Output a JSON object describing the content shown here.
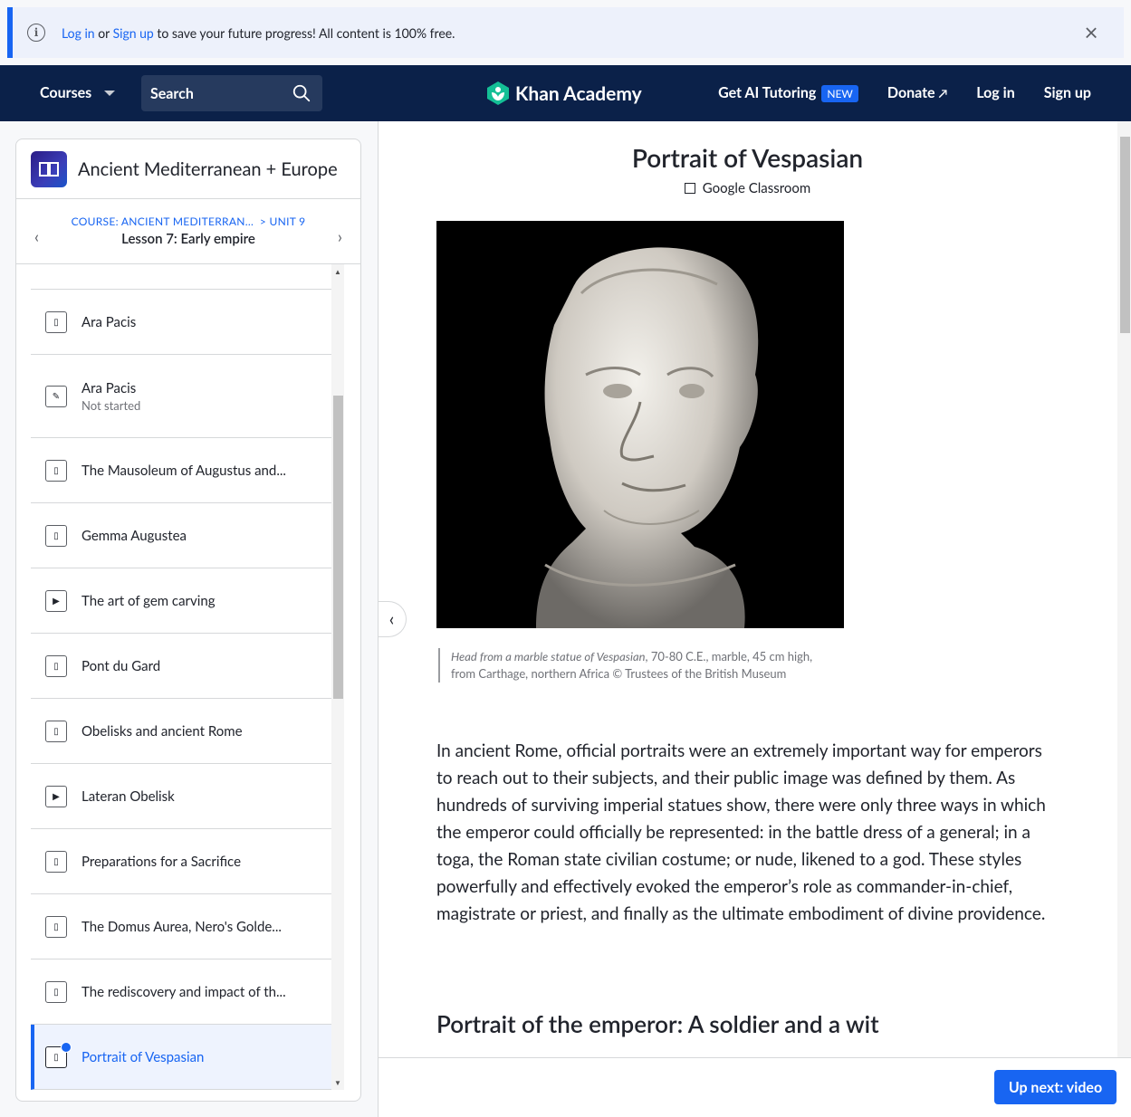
{
  "banner": {
    "login": "Log in",
    "or": "or",
    "signup": "Sign up",
    "message": "to save your future progress! All content is 100% free."
  },
  "header": {
    "courses": "Courses",
    "search_label": "Search",
    "logo_text": "Khan Academy",
    "ai_tutoring": "Get AI Tutoring",
    "new_badge": "NEW",
    "donate": "Donate",
    "login": "Log in",
    "signup": "Sign up",
    "colors": {
      "bg": "#0b2149",
      "accent": "#1865f2",
      "logo_green": "#14bf96"
    }
  },
  "sidebar": {
    "course_title": "Ancient Mediterranean + Europe",
    "breadcrumb_course": "COURSE: ANCIENT MEDITERRAN...",
    "breadcrumb_unit": "> UNIT 9",
    "lesson_title": "Lesson 7: Early empire",
    "items": [
      {
        "label": "Ara Pacis",
        "icon": "article-icon",
        "sub": ""
      },
      {
        "label": "Ara Pacis",
        "icon": "exercise-icon",
        "sub": "Not started"
      },
      {
        "label": "The Mausoleum of Augustus and...",
        "icon": "article-icon",
        "sub": ""
      },
      {
        "label": "Gemma Augustea",
        "icon": "article-icon",
        "sub": ""
      },
      {
        "label": "The art of gem carving",
        "icon": "video-icon",
        "sub": ""
      },
      {
        "label": "Pont du Gard",
        "icon": "article-icon",
        "sub": ""
      },
      {
        "label": "Obelisks and ancient Rome",
        "icon": "article-icon",
        "sub": ""
      },
      {
        "label": "Lateran Obelisk",
        "icon": "video-icon",
        "sub": ""
      },
      {
        "label": "Preparations for a Sacrifice",
        "icon": "article-icon",
        "sub": ""
      },
      {
        "label": "The Domus Aurea, Nero's Golde...",
        "icon": "article-icon",
        "sub": ""
      },
      {
        "label": "The rediscovery and impact of th...",
        "icon": "article-icon",
        "sub": ""
      },
      {
        "label": "Portrait of Vespasian",
        "icon": "article-icon",
        "sub": ""
      }
    ]
  },
  "main": {
    "title": "Portrait of Vespasian",
    "google_classroom": "Google Classroom",
    "caption_italic": "Head from a marble statue of Vespasian",
    "caption_rest": ", 70-80 C.E., marble, 45 cm high, from Carthage, northern Africa © Trustees of the British Museum",
    "body": "In ancient Rome, official portraits were an extremely important way for emperors to reach out to their subjects, and their public image was defined by them. As hundreds of surviving imperial statues show, there were only three ways in which the emperor could officially be represented: in the battle dress of a general; in a toga, the Roman state civilian costume; or nude, likened to a god. These styles powerfully and effectively evoked the emperor’s role as commander-in-chief, magistrate or priest, and finally as the ultimate embodiment of divine providence.",
    "heading2": "Portrait of the emperor: A soldier and a wit",
    "up_next": "Up next: video"
  }
}
